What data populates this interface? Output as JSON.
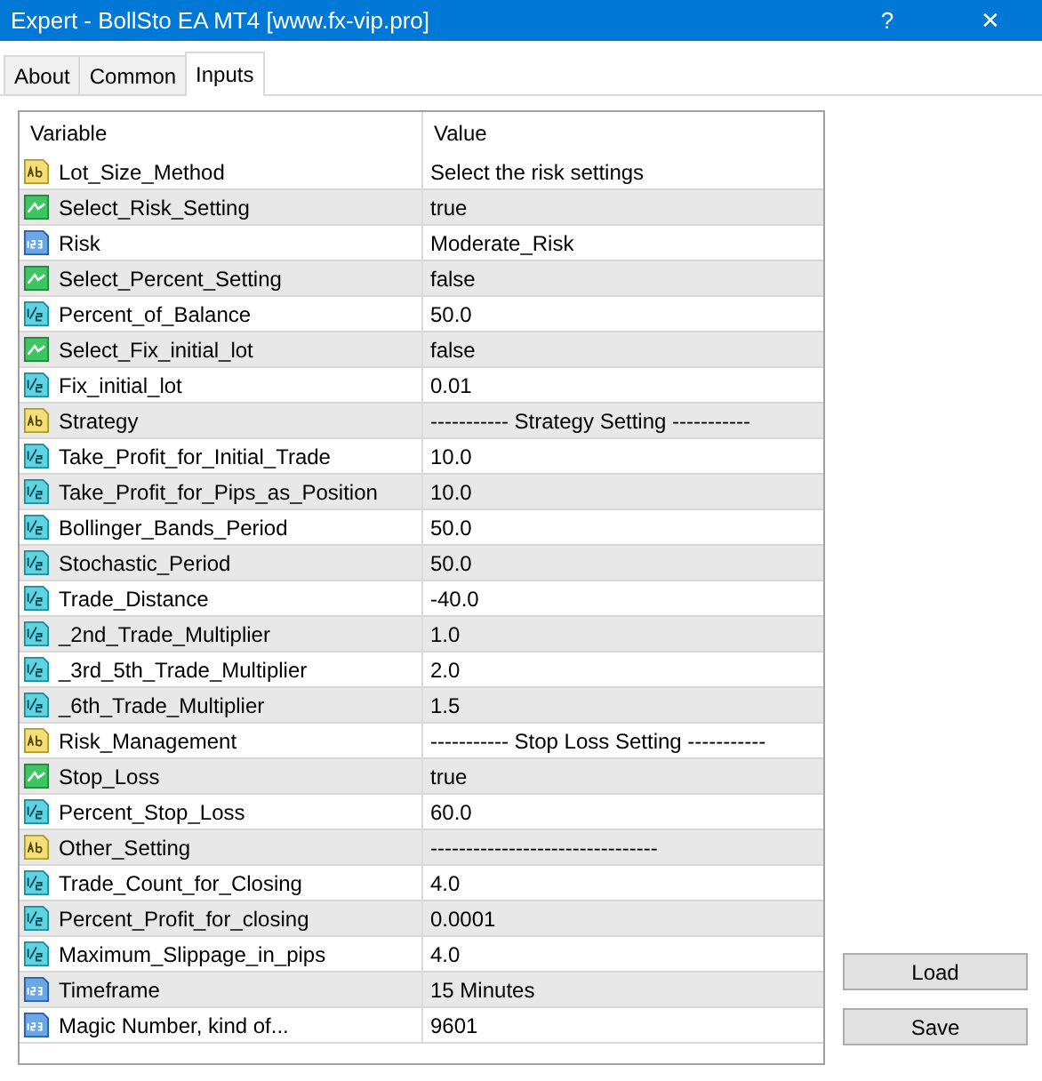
{
  "window": {
    "title": "Expert - BollSto EA MT4 [www.fx-vip.pro]",
    "help": "?",
    "close": "✕"
  },
  "tabs": [
    {
      "label": "About",
      "selected": false
    },
    {
      "label": "Common",
      "selected": false
    },
    {
      "label": "Inputs",
      "selected": true
    }
  ],
  "table": {
    "columns": [
      "Variable",
      "Value"
    ],
    "rows": [
      {
        "kind": "string",
        "variable": "Lot_Size_Method",
        "value": "Select the risk settings"
      },
      {
        "kind": "bool",
        "variable": "Select_Risk_Setting",
        "value": "true"
      },
      {
        "kind": "enum",
        "variable": "Risk",
        "value": "Moderate_Risk"
      },
      {
        "kind": "bool",
        "variable": "Select_Percent_Setting",
        "value": "false"
      },
      {
        "kind": "double",
        "variable": "Percent_of_Balance",
        "value": "50.0"
      },
      {
        "kind": "bool",
        "variable": "Select_Fix_initial_lot",
        "value": "false"
      },
      {
        "kind": "double",
        "variable": "Fix_initial_lot",
        "value": "0.01"
      },
      {
        "kind": "string",
        "variable": "Strategy",
        "value": "----------- Strategy Setting -----------"
      },
      {
        "kind": "double",
        "variable": "Take_Profit_for_Initial_Trade",
        "value": "10.0"
      },
      {
        "kind": "double",
        "variable": "Take_Profit_for_Pips_as_Position",
        "value": "10.0"
      },
      {
        "kind": "double",
        "variable": "Bollinger_Bands_Period",
        "value": "50.0"
      },
      {
        "kind": "double",
        "variable": "Stochastic_Period",
        "value": "50.0"
      },
      {
        "kind": "double",
        "variable": "Trade_Distance",
        "value": "-40.0"
      },
      {
        "kind": "double",
        "variable": "_2nd_Trade_Multiplier",
        "value": "1.0"
      },
      {
        "kind": "double",
        "variable": "_3rd_5th_Trade_Multiplier",
        "value": "2.0"
      },
      {
        "kind": "double",
        "variable": "_6th_Trade_Multiplier",
        "value": "1.5"
      },
      {
        "kind": "string",
        "variable": "Risk_Management",
        "value": "----------- Stop Loss Setting -----------"
      },
      {
        "kind": "bool",
        "variable": "Stop_Loss",
        "value": "true"
      },
      {
        "kind": "double",
        "variable": "Percent_Stop_Loss",
        "value": "60.0"
      },
      {
        "kind": "string",
        "variable": "Other_Setting",
        "value": "--------------------------------"
      },
      {
        "kind": "double",
        "variable": "Trade_Count_for_Closing",
        "value": "4.0"
      },
      {
        "kind": "double",
        "variable": "Percent_Profit_for_closing",
        "value": "0.0001"
      },
      {
        "kind": "double",
        "variable": "Maximum_Slippage_in_pips",
        "value": "4.0"
      },
      {
        "kind": "enum",
        "variable": "Timeframe",
        "value": "15 Minutes"
      },
      {
        "kind": "enum",
        "variable": "Magic Number, kind of...",
        "value": "9601"
      }
    ]
  },
  "buttons": [
    "Load",
    "Save"
  ]
}
